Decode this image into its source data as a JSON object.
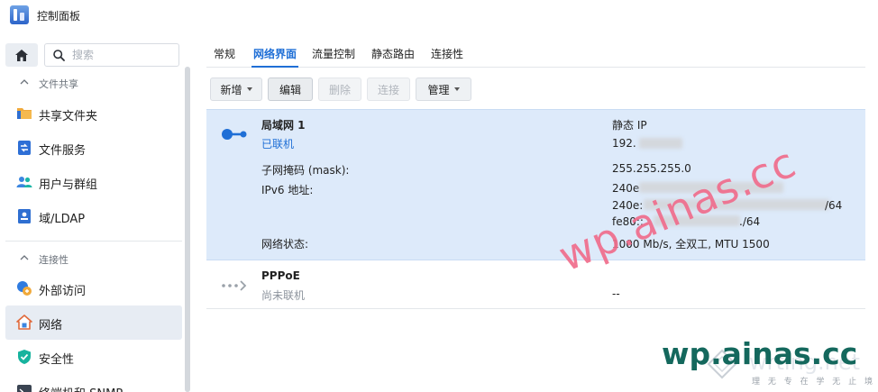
{
  "window": {
    "title": "控制面板"
  },
  "sidebar": {
    "search_placeholder": "搜索",
    "groups": [
      {
        "label": "文件共享",
        "items": [
          {
            "label": "共享文件夹",
            "icon": "folder-icon"
          },
          {
            "label": "文件服务",
            "icon": "file-service-icon"
          },
          {
            "label": "用户与群组",
            "icon": "users-icon"
          },
          {
            "label": "域/LDAP",
            "icon": "domain-ldap-icon"
          }
        ]
      },
      {
        "label": "连接性",
        "items": [
          {
            "label": "外部访问",
            "icon": "external-access-icon"
          },
          {
            "label": "网络",
            "icon": "network-house-icon",
            "active": true
          },
          {
            "label": "安全性",
            "icon": "shield-icon"
          },
          {
            "label": "终端机和 SNMP",
            "icon": "terminal-icon"
          }
        ]
      }
    ]
  },
  "tabs": [
    {
      "label": "常规"
    },
    {
      "label": "网络界面",
      "active": true
    },
    {
      "label": "流量控制"
    },
    {
      "label": "静态路由"
    },
    {
      "label": "连接性"
    }
  ],
  "toolbar": {
    "create_label": "新增",
    "edit_label": "编辑",
    "delete_label": "删除",
    "connect_label": "连接",
    "manage_label": "管理"
  },
  "interfaces": {
    "lan": {
      "name": "局域网 1",
      "status": "已联机",
      "ip_type": "静态 IP",
      "ip": "192.",
      "mask_label": "子网掩码 (mask):",
      "mask": "255.255.255.0",
      "ipv6_label": "IPv6 地址:",
      "ipv6_1": "240e",
      "ipv6_2": "240e:",
      "ipv6_2_tail": "/64",
      "ipv6_3": "fe80::",
      "ipv6_3_tail": "./64",
      "net_status_label": "网络状态:",
      "net_status": "1000 Mb/s, 全双工, MTU 1500"
    },
    "pppoe": {
      "name": "PPPoE",
      "status": "尚未联机",
      "value": "--"
    }
  },
  "watermarks": {
    "pink": "wp.ainas.cc",
    "green": "wp.ainas.cc",
    "gray": "wrting.net",
    "slogan": "理 无 专 在   学 无 止 境"
  },
  "colors": {
    "accent": "#1f6fd6",
    "selected_row": "#ddeafa",
    "watermark_pink": "#f06d8c",
    "watermark_green": "#14685d"
  }
}
